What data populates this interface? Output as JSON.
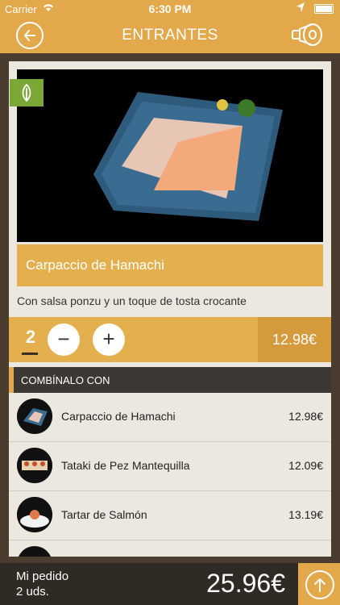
{
  "status_bar": {
    "carrier": "Carrier",
    "time": "6:30 PM"
  },
  "nav": {
    "title": "ENTRANTES",
    "back_icon": "arrow-left-icon",
    "right_icon": "ham-leg-icon"
  },
  "dish": {
    "name": "Carpaccio de Hamachi",
    "description": "Con salsa ponzu y un toque de tosta crocante",
    "badge_icon": "leaf-icon"
  },
  "quantity": {
    "value": "2",
    "minus": "−",
    "plus": "+",
    "price": "12.98€"
  },
  "combine": {
    "title": "COMBÍNALO CON",
    "items": [
      {
        "name": "Carpaccio de Hamachi",
        "price": "12.98€"
      },
      {
        "name": "Tataki de Pez Mantequilla",
        "price": "12.09€"
      },
      {
        "name": "Tartar de Salmón",
        "price": "13.19€"
      }
    ]
  },
  "footer": {
    "order_label": "Mi pedido",
    "units": "2 uds.",
    "total": "25.96€",
    "action_icon": "arrow-up-icon"
  },
  "colors": {
    "accent": "#e3a84a",
    "title_bar": "#e3b04d",
    "price_box": "#d49a3c",
    "veg_badge": "#7aa736"
  }
}
